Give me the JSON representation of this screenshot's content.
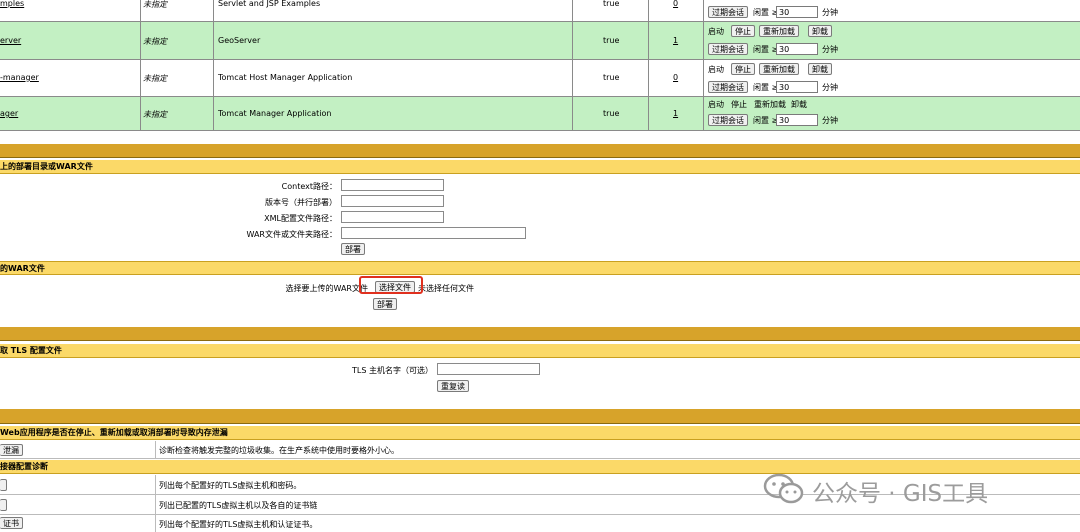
{
  "apps": [
    {
      "path": "...mples",
      "version": "未指定",
      "name": "Servlet and JSP Examples",
      "running": "true",
      "sessions": "0",
      "show_commands": false
    },
    {
      "path": "...erver",
      "version": "未指定",
      "name": "GeoServer",
      "running": "true",
      "sessions": "1",
      "show_commands": true
    },
    {
      "path": "...-manager",
      "version": "未指定",
      "name": "Tomcat Host Manager Application",
      "running": "true",
      "sessions": "0",
      "show_commands": true
    },
    {
      "path": "...ager",
      "version": "未指定",
      "name": "Tomcat Manager Application",
      "running": "true",
      "sessions": "1",
      "show_commands": true
    }
  ],
  "apps_display": [
    "mples",
    "erver",
    "-manager",
    "ager"
  ],
  "commands": {
    "start": "启动",
    "stop": "停止",
    "reload": "重新加载",
    "undeploy": "卸载"
  },
  "expire": {
    "button": "过期会话",
    "idle": "闲置 ≥",
    "value": "30",
    "unit": "分钟"
  },
  "deploy": {
    "server_header": "上的部署目录或WAR文件",
    "context_label": "Context路径：",
    "version_label": "版本号（并行部署）",
    "xml_label": "XML配置文件路径：",
    "war_label": "WAR文件或文件夹路径：",
    "deploy_button": "部署",
    "upload_header": "的WAR文件",
    "upload_label": "选择要上传的WAR文件",
    "choose_button": "选择文件",
    "no_file": "未选择任何文件",
    "upload_button": "部署"
  },
  "tls": {
    "header": "取 TLS 配置文件",
    "host_label": "TLS 主机名字（可选）",
    "reload_button": "重复读"
  },
  "diagnostics": {
    "header": "Web应用程序是否在停止、重新加载或取消部署时导致内存泄漏",
    "leak_button": "泄漏",
    "leak_desc": "诊断检查将触发完整的垃圾收集。在生产系统中使用时要格外小心。",
    "connector_header": "接器配置诊断",
    "rows": [
      {
        "button": "",
        "desc": "列出每个配置好的TLS虚拟主机和密码。"
      },
      {
        "button": "",
        "desc": "列出已配置的TLS虚拟主机以及各自的证书链"
      },
      {
        "button": "证书",
        "desc": "列出每个配置好的TLS虚拟主机和认证证书。"
      }
    ]
  },
  "watermark": "公众号 · GIS工具"
}
